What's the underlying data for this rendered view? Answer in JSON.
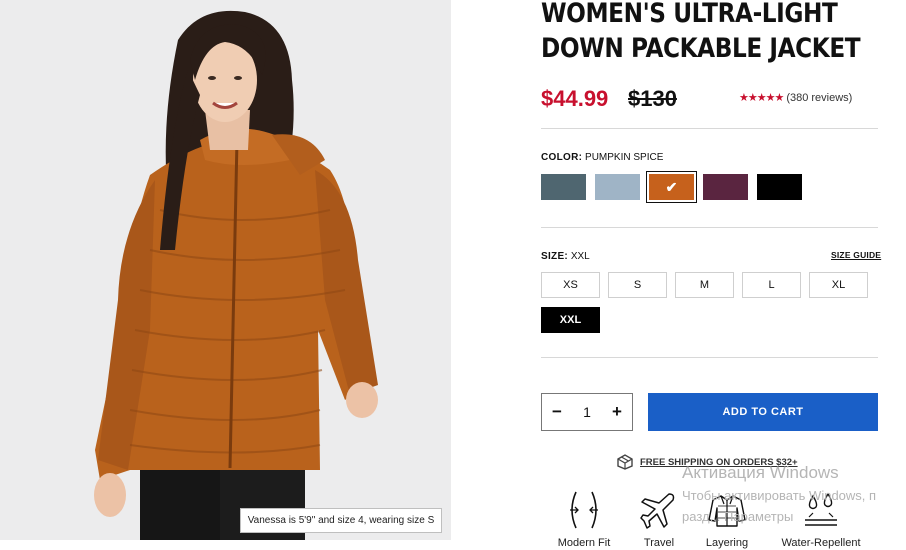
{
  "product": {
    "title": "WOMEN'S ULTRA-LIGHT DOWN PACKABLE JACKET",
    "price": "$44.99",
    "original_price": "$130",
    "rating_stars": 5,
    "rating_text": "★★★★★",
    "reviews": "(380 reviews)"
  },
  "image": {
    "model_caption": "Vanessa is 5'9\" and size 4, wearing size S"
  },
  "color": {
    "label": "COLOR:",
    "selected": "PUMPKIN SPICE",
    "swatches": [
      {
        "name": "slate",
        "hex": "#4f6670"
      },
      {
        "name": "light-blue",
        "hex": "#9fb4c6"
      },
      {
        "name": "pumpkin-spice",
        "hex": "#c6611c",
        "selected": true
      },
      {
        "name": "plum",
        "hex": "#5a2540"
      },
      {
        "name": "black",
        "hex": "#000000"
      }
    ],
    "check_glyph": "✔"
  },
  "size": {
    "label": "SIZE:",
    "selected": "XXL",
    "guide": "SIZE GUIDE",
    "options": [
      "XS",
      "S",
      "M",
      "L",
      "XL",
      "XXL"
    ]
  },
  "cart": {
    "minus": "−",
    "plus": "+",
    "quantity": "1",
    "add_label": "ADD TO CART"
  },
  "shipping": {
    "text": "FREE SHIPPING ON ORDERS $32+",
    "icon": "box-icon"
  },
  "features": [
    {
      "label": "Modern Fit",
      "icon": "modern-fit-icon"
    },
    {
      "label": "Travel",
      "icon": "airplane-icon"
    },
    {
      "label": "Layering",
      "icon": "layering-jacket-icon"
    },
    {
      "label": "Water-Repellent",
      "icon": "water-repellent-icon"
    }
  ],
  "watermark": {
    "line1": "Активация Windows",
    "line2": "Чтобы активировать Windows, п",
    "line3": "разд... Параметры"
  },
  "colors": {
    "sale_red": "#c8102e",
    "cta_blue": "#1a5fc7"
  }
}
